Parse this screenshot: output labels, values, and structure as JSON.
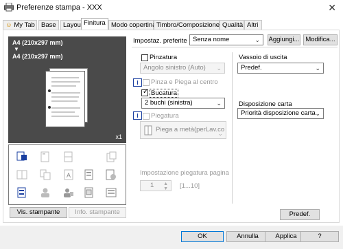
{
  "window": {
    "title": "Preferenze stampa - XXX"
  },
  "tabs": [
    {
      "label": "My Tab"
    },
    {
      "label": "Base"
    },
    {
      "label": "Layout"
    },
    {
      "label": "Finitura"
    },
    {
      "label": "Modo copertina"
    },
    {
      "label": "Timbro/Composizione"
    },
    {
      "label": "Qualità"
    },
    {
      "label": "Altri"
    }
  ],
  "preview": {
    "paper_size_1": "A4 (210x297 mm)",
    "arrow": "▼",
    "paper_size_2": "A4 (210x297 mm)",
    "copies": "x1"
  },
  "left_buttons": {
    "view_printer": "Vis. stampante",
    "printer_info": "Info. stampante"
  },
  "settings": {
    "favorite_label": "Impostaz. preferite",
    "favorite_value": "Senza nome",
    "add_button": "Aggiungi...",
    "modify_button": "Modifica..."
  },
  "finishing": {
    "staple_label": "Pinzatura",
    "staple_value": "Angolo sinistro (Auto)",
    "staple_fold_label": "Pinza e Piega al centro",
    "punch_label": "Bucatura",
    "punch_checked": true,
    "punch_value": "2 buchi (sinistra)",
    "fold_label": "Piegatura",
    "fold_value": "Piega a metà(perLav.co",
    "fold_page_setting": "Impostazione piegatura pagina",
    "fold_page_value": "1",
    "fold_page_range": "[1...10]"
  },
  "output": {
    "tray_label": "Vassoio di uscita",
    "tray_value": "Predef.",
    "paper_arrangement_label": "Disposizione carta",
    "paper_arrangement_value": "Priorità disposizione carta"
  },
  "panel_buttons": {
    "default": "Predef."
  },
  "dialog_buttons": {
    "ok": "OK",
    "cancel": "Annulla",
    "apply": "Applica",
    "help": "?"
  }
}
